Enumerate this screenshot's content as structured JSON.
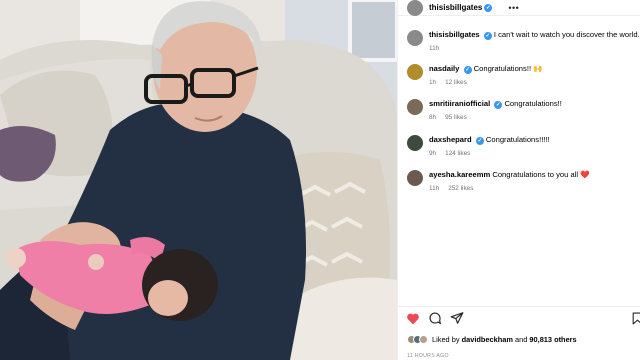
{
  "post": {
    "username": "thisisbillgates",
    "caption": "I can't wait to watch you discover the world.",
    "caption_age": "11h"
  },
  "comments": [
    {
      "user": "nasdaily",
      "text": "Congratulations!! 🙌",
      "age": "1h",
      "likes": "12 likes",
      "verified": true,
      "avatar_color": "#b08d2a"
    },
    {
      "user": "smritiiraniofficial",
      "text": "Congratulations!!",
      "age": "8h",
      "likes": "95 likes",
      "verified": true,
      "avatar_color": "#7a6a58"
    },
    {
      "user": "daxshepard",
      "text": "Congratulations!!!!!",
      "age": "9h",
      "likes": "124 likes",
      "verified": true,
      "avatar_color": "#3d4a3f"
    },
    {
      "user": "ayesha.kareemm",
      "text": "Congratulations to you all ❤️",
      "age": "11h",
      "likes": "252 likes",
      "verified": false,
      "avatar_color": "#6d5a4f"
    }
  ],
  "likes": {
    "prefix": "Liked by",
    "first_user": "davidbeckham",
    "conjunction": "and",
    "others": "90,813 others"
  },
  "timestamp": "11 HOURS AGO",
  "icons": [
    "more-icon",
    "heart-icon",
    "comment-icon",
    "share-icon",
    "bookmark-icon",
    "verified-badge"
  ],
  "colors": {
    "verified": "#3897f0",
    "like": "#ed4956",
    "meta": "#737373"
  }
}
